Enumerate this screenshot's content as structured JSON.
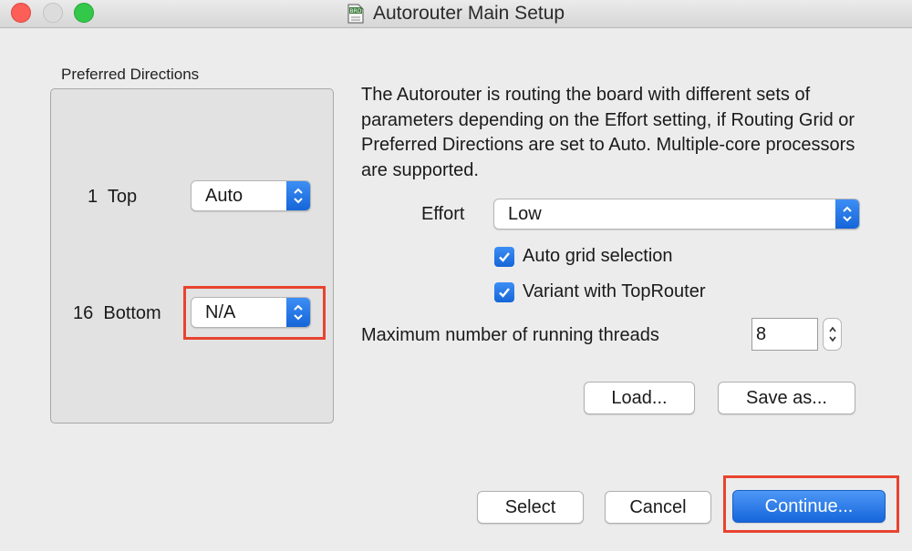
{
  "window": {
    "title": "Autorouter Main Setup",
    "doc_icon_label": "BRD"
  },
  "preferred_directions": {
    "title": "Preferred Directions",
    "layers": [
      {
        "label": "1  Top",
        "value": "Auto"
      },
      {
        "label": "16  Bottom",
        "value": "N/A"
      }
    ]
  },
  "description": "The Autorouter is routing the board with different sets of parameters depending on the Effort setting, if Routing Grid or Preferred Directions are set to Auto. Multiple-core processors are supported.",
  "effort": {
    "label": "Effort",
    "value": "Low"
  },
  "checkboxes": [
    {
      "label": "Auto grid selection",
      "checked": true
    },
    {
      "label": "Variant with TopRouter",
      "checked": true
    }
  ],
  "threads": {
    "label": "Maximum number of running threads",
    "value": "8"
  },
  "buttons": {
    "load": "Load...",
    "save_as": "Save as...",
    "select": "Select",
    "cancel": "Cancel",
    "continue": "Continue..."
  },
  "colors": {
    "accent": "#1565d8",
    "highlight": "#e8432f",
    "close": "#fc5f57",
    "maximize": "#34c84a"
  }
}
